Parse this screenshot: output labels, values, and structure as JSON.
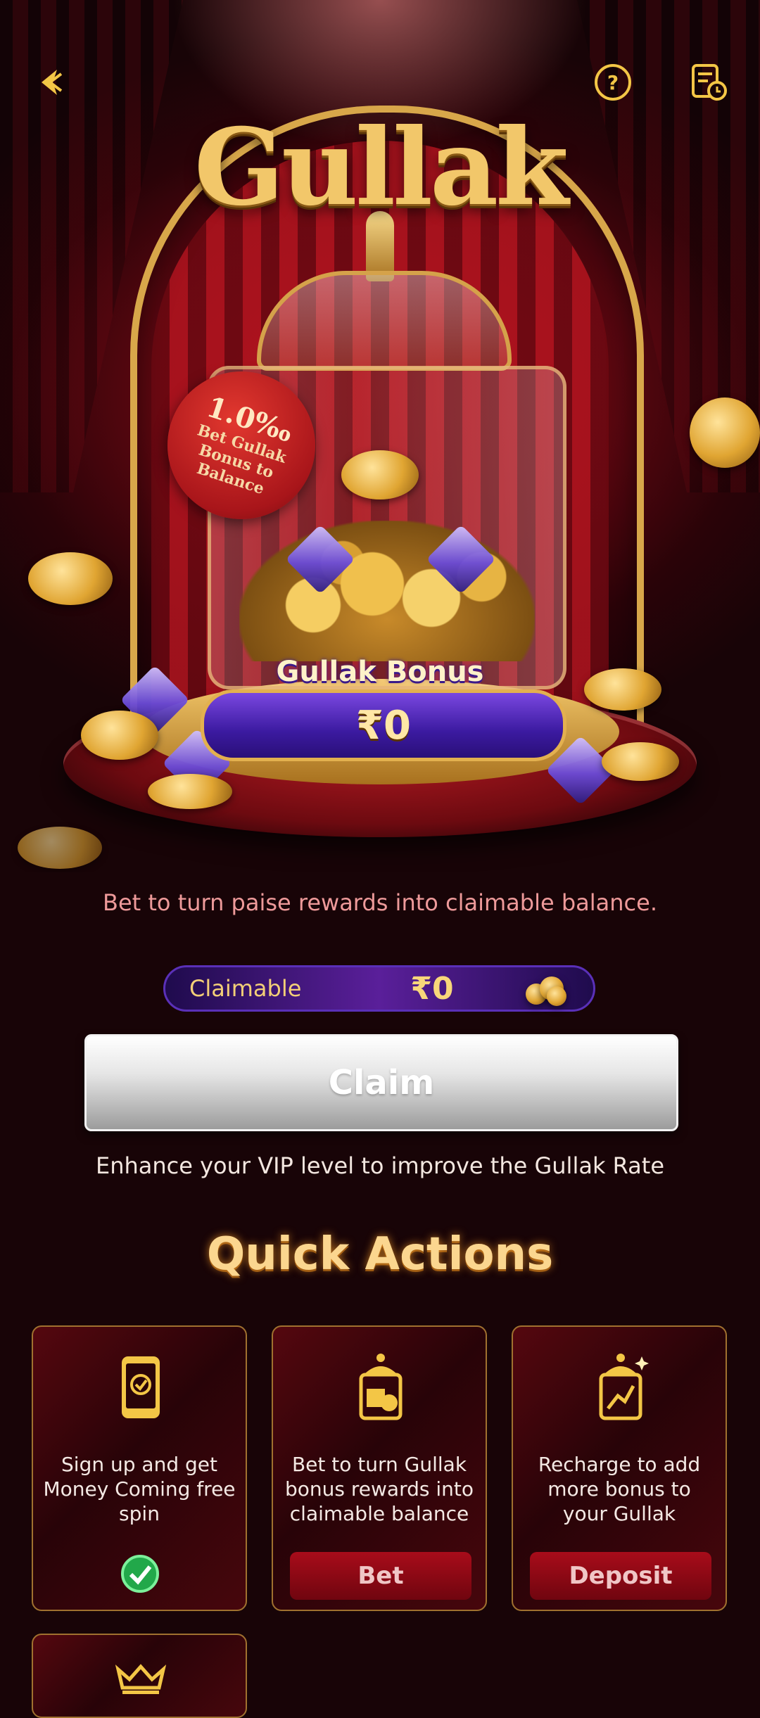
{
  "header": {
    "back_icon": "back-arrow-icon",
    "help_icon": "question-circle-icon",
    "records_icon": "records-clock-icon"
  },
  "hero": {
    "title": "Gullak",
    "tag_percent": "1.0‰",
    "tag_text": "Bet Gullak Bonus to Balance",
    "bonus_label": "Gullak Bonus",
    "bonus_value": "₹0"
  },
  "hint_top": "Bet to turn paise rewards into claimable balance.",
  "claimable": {
    "label": "Claimable",
    "value": "₹0",
    "icon": "coin-stack-icon"
  },
  "claim_button": "Claim",
  "hint_bottom": "Enhance your VIP level to improve the Gullak Rate",
  "quick_actions": {
    "title": "Quick Actions",
    "cards": [
      {
        "icon": "phone-check-icon",
        "text": "Sign up and get Money Coming free spin",
        "status": "completed"
      },
      {
        "icon": "jar-bet-icon",
        "text": "Bet to turn Gullak bonus rewards into claimable balance",
        "button": "Bet"
      },
      {
        "icon": "jar-recharge-icon",
        "text": "Recharge to add more bonus to your Gullak",
        "button": "Deposit"
      },
      {
        "icon": "crown-icon"
      }
    ]
  },
  "colors": {
    "gold": "#f3cf77",
    "accent_red": "#a80c1a",
    "purple": "#5a1f9a",
    "pink_text": "#ee9a9a"
  }
}
